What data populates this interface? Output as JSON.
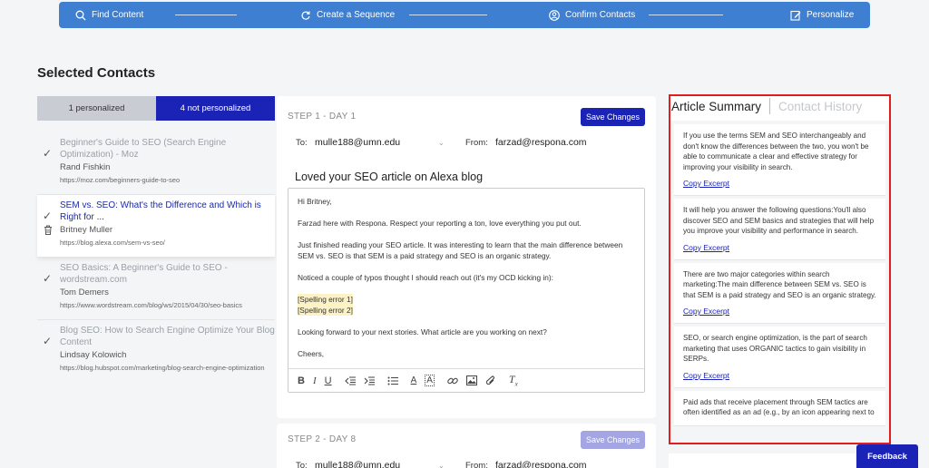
{
  "stepper": {
    "steps": [
      {
        "label": "Find Content",
        "icon": "search-icon"
      },
      {
        "label": "Create a Sequence",
        "icon": "refresh-icon"
      },
      {
        "label": "Confirm Contacts",
        "icon": "user-icon"
      },
      {
        "label": "Personalize",
        "icon": "edit-icon"
      }
    ]
  },
  "page_title": "Selected Contacts",
  "tabs": {
    "personalized": "1 personalized",
    "not_personalized": "4 not personalized"
  },
  "contacts": [
    {
      "title": "Beginner's Guide to SEO (Search Engine Optimization) - Moz",
      "author": "Rand Fishkin",
      "url": "https://moz.com/beginners-guide-to-seo"
    },
    {
      "title": "SEM vs. SEO: What's the Difference and Which is Right for ...",
      "author": "Britney Muller",
      "url": "https://blog.alexa.com/sem-vs-seo/"
    },
    {
      "title": "SEO Basics: A Beginner's Guide to SEO - wordstream.com",
      "author": "Tom Demers",
      "url": "https://www.wordstream.com/blog/ws/2015/04/30/seo-basics"
    },
    {
      "title": "Blog SEO: How to Search Engine Optimize Your Blog Content",
      "author": "Lindsay Kolowich",
      "url": "https://blog.hubspot.com/marketing/blog-search-engine-optimization"
    }
  ],
  "email1": {
    "step": "STEP 1 - DAY 1",
    "save": "Save Changes",
    "to_label": "To:",
    "to": "mulle188@umn.edu",
    "from_label": "From:",
    "from": "farzad@respona.com",
    "subject": "Loved your SEO article on Alexa blog",
    "body": {
      "greeting": "Hi Britney,",
      "p1": "Farzad here with Respona. Respect your reporting a ton, love everything you put out.",
      "p2": "Just finished reading your SEO article. It was interesting to learn that the main difference between SEM vs. SEO is that SEM is a paid strategy and SEO is an organic strategy.",
      "p3": "Noticed a couple of typos thought I should reach out (it's my OCD kicking in):",
      "err1": "[Spelling error 1]",
      "err2": "[Spelling error 2]",
      "p4": "Looking forward to your next stories. What article are you working on next?",
      "closing": "Cheers,"
    }
  },
  "email2": {
    "step": "STEP 2 - DAY 8",
    "save": "Save Changes",
    "to_label": "To:",
    "to": "mulle188@umn.edu",
    "from_label": "From:",
    "from": "farzad@respona.com"
  },
  "side_panel": {
    "tab_active": "Article Summary",
    "tab_inactive": "Contact History",
    "link_label": "Copy Excerpt",
    "excerpts": [
      "If you use the terms SEM and SEO interchangeably and don't know the differences between the two, you won't be able to communicate a clear and effective strategy for improving your visibility in search.",
      "It will help you answer the following questions:You'll also discover SEO and SEM basics and strategies that will help you improve your visibility and performance in search.",
      "There are two major categories within search marketing:The main difference between SEM vs. SEO is that SEM is a paid strategy and SEO is an organic strategy.",
      "SEO, or search engine optimization, is the part of search marketing that uses ORGANIC tactics to gain visibility in SERPs.",
      "Paid ads that receive placement through SEM tactics are often identified as an ad (e.g., by an icon appearing next to"
    ]
  },
  "feedback": "Feedback",
  "colors": {
    "accent": "#1a23b5",
    "stepper": "#3f7fd1",
    "highlight": "#e11d1d"
  }
}
